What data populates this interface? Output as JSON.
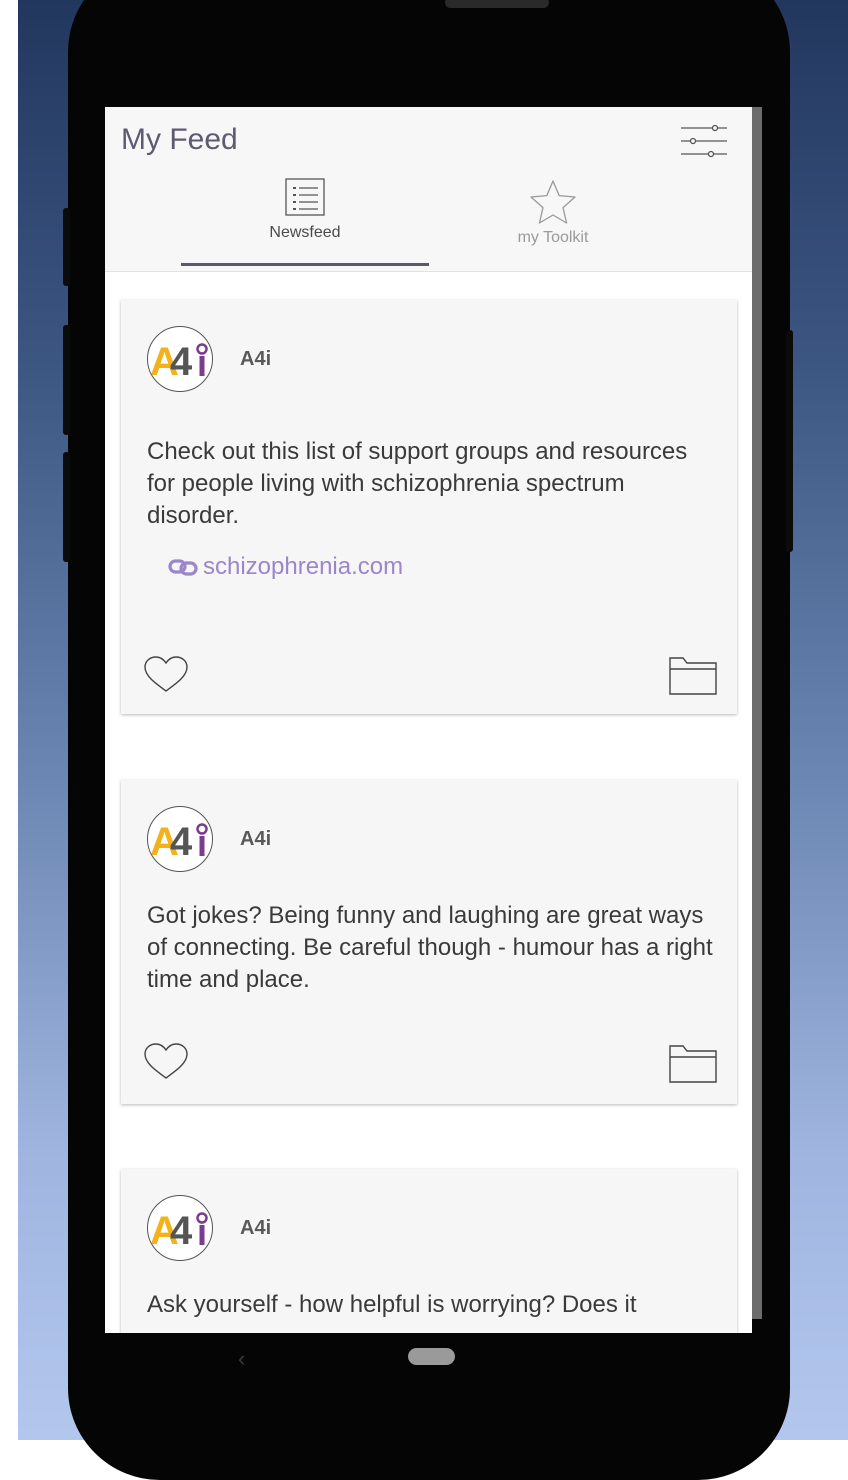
{
  "header": {
    "title": "My Feed"
  },
  "tabs": [
    {
      "label": "Newsfeed",
      "icon": "list-icon",
      "active": true
    },
    {
      "label": "my Toolkit",
      "icon": "star-icon",
      "active": false
    }
  ],
  "posts": [
    {
      "author": "A4i",
      "text": "Check out this list of support groups and resources for people living with schizophrenia spectrum disorder.",
      "link": "schizophrenia.com"
    },
    {
      "author": "A4i",
      "text": "Got jokes? Being funny and laughing are great ways of connecting. Be careful though - humour has a right time and place."
    },
    {
      "author": "A4i",
      "text": "Ask yourself - how helpful is worrying? Does it"
    }
  ],
  "colors": {
    "accent": "#5d586b",
    "link": "#9a86c9",
    "logo_yellow": "#f2b21b",
    "logo_purple": "#7a3c8f"
  }
}
